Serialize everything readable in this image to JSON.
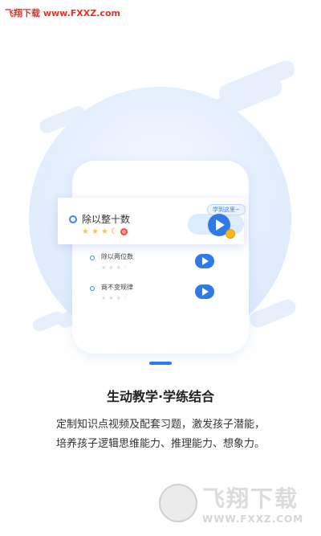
{
  "watermark_top": "飞翔下载 www.FXXZ.com",
  "card": {
    "title": "除以整十数",
    "bubble": "学到这里~",
    "stars_filled": 3
  },
  "rows": [
    {
      "label": "除以两位数"
    },
    {
      "label": "商不变规律"
    }
  ],
  "heading": "生动教学·学练结合",
  "description": [
    "定制知识点视频及配套习题，激发孩子潜能，",
    "培养孩子逻辑思维能力、推理能力、想象力。"
  ],
  "watermark_logo": {
    "main": "飞翔下载",
    "sub": "WWW.FXXZ.COM"
  },
  "colors": {
    "accent": "#2f79e8",
    "star": "#f6c343",
    "red_badge": "#f04b3f"
  }
}
